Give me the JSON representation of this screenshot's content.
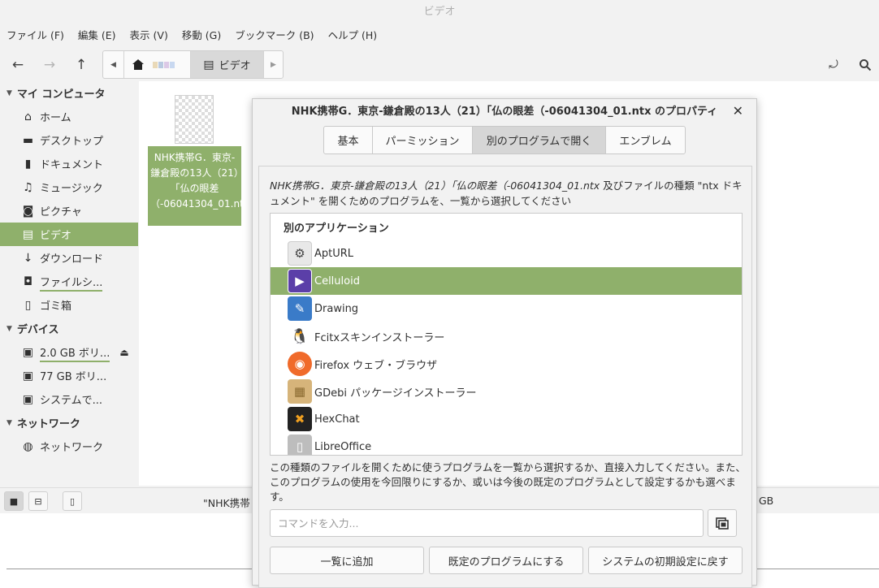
{
  "window": {
    "title": "ビデオ"
  },
  "menu": [
    "ファイル (F)",
    "編集 (E)",
    "表示 (V)",
    "移動 (G)",
    "ブックマーク (B)",
    "ヘルプ (H)"
  ],
  "toolbar": {
    "back_icon": "←",
    "forward_icon": "→",
    "up_icon": "↑",
    "path_current": "ビデオ",
    "reload_icon": "⤾",
    "search_icon": "⌕"
  },
  "sidebar": {
    "sections": [
      {
        "header": "マイ コンピュータ",
        "items": [
          {
            "label": "ホーム",
            "icon": "home-icon",
            "glyph": "⌂"
          },
          {
            "label": "デスクトップ",
            "icon": "desktop-icon",
            "glyph": "▬"
          },
          {
            "label": "ドキュメント",
            "icon": "document-icon",
            "glyph": "▮"
          },
          {
            "label": "ミュージック",
            "icon": "music-icon",
            "glyph": "♫"
          },
          {
            "label": "ピクチャ",
            "icon": "camera-icon",
            "glyph": "◙"
          },
          {
            "label": "ビデオ",
            "icon": "film-icon",
            "glyph": "▤",
            "selected": true
          },
          {
            "label": "ダウンロード",
            "icon": "download-icon",
            "glyph": "↓"
          },
          {
            "label": "ファイルシ...",
            "icon": "drive-icon",
            "glyph": "◘"
          },
          {
            "label": "ゴミ箱",
            "icon": "trash-icon",
            "glyph": "▯"
          }
        ]
      },
      {
        "header": "デバイス",
        "items": [
          {
            "label": "2.0 GB ボリ...",
            "icon": "sd-card-icon",
            "glyph": "▣",
            "eject": "⏏"
          },
          {
            "label": "77 GB ボリ...",
            "icon": "disk-icon",
            "glyph": "▣"
          },
          {
            "label": "システムで...",
            "icon": "disk-icon",
            "glyph": "▣"
          }
        ]
      },
      {
        "header": "ネットワーク",
        "items": [
          {
            "label": "ネットワーク",
            "icon": "network-icon",
            "glyph": "◍"
          }
        ]
      }
    ]
  },
  "file": {
    "name": "NHK携帯G．東京-鎌倉殿の13人（21）「仏の眼差（-06041304_01.ntx"
  },
  "statusbar": {
    "text": "\"NHK携帯",
    "right": "GB"
  },
  "dialog": {
    "title": "NHK携帯G．東京-鎌倉殿の13人（21）「仏の眼差（-06041304_01.ntx のプロパティ",
    "tabs": [
      "基本",
      "パーミッション",
      "別のプログラムで開く",
      "エンブレム"
    ],
    "active_tab": 2,
    "description_file": "NHK携帯G．東京-鎌倉殿の13人（21）「仏の眼差（-06041304_01.ntx",
    "description_rest": " 及びファイルの種類 \"ntx ドキュメント\" を開くためのプログラムを、一覧から選択してください",
    "list_header": "別のアプリケーション",
    "apps": [
      {
        "label": "AptURL",
        "icon": "gear-icon",
        "glyph": "⚙",
        "color": "#e8e8e8",
        "fg": "#444"
      },
      {
        "label": "Celluloid",
        "icon": "celluloid-icon",
        "glyph": "▶",
        "color": "#5b3fa8",
        "fg": "#ffffff",
        "selected": true
      },
      {
        "label": "Drawing",
        "icon": "drawing-icon",
        "glyph": "✎",
        "color": "#3a7bc8",
        "fg": "#ffffff"
      },
      {
        "label": "Fcitxスキンインストーラー",
        "icon": "penguin-icon",
        "glyph": "🐧",
        "color": "#ffffff",
        "fg": "#000"
      },
      {
        "label": "Firefox ウェブ・ブラウザ",
        "icon": "firefox-icon",
        "glyph": "◉",
        "color": "#f06a2a",
        "fg": "#ffffff"
      },
      {
        "label": "GDebi パッケージインストーラー",
        "icon": "package-icon",
        "glyph": "▦",
        "color": "#d6b47a",
        "fg": "#8a6a30"
      },
      {
        "label": "HexChat",
        "icon": "hexchat-icon",
        "glyph": "✖",
        "color": "#222222",
        "fg": "#f0a020"
      },
      {
        "label": "LibreOffice",
        "icon": "libreoffice-icon",
        "glyph": "▯",
        "color": "#bdbdbd",
        "fg": "#ffffff"
      }
    ],
    "hint": "この種類のファイルを開くために使うプログラムを一覧から選択するか、直接入力してください。また、このプログラムの使用を今回限りにするか、或いは今後の既定のプログラムとして設定するかも選べます。",
    "command_placeholder": "コマンドを入力...",
    "buttons": {
      "add": "一覧に追加",
      "set_default": "既定のプログラムにする",
      "reset": "システムの初期設定に戻す"
    },
    "close_icon": "✕"
  },
  "colors": {
    "accent": "#8fb06b"
  }
}
